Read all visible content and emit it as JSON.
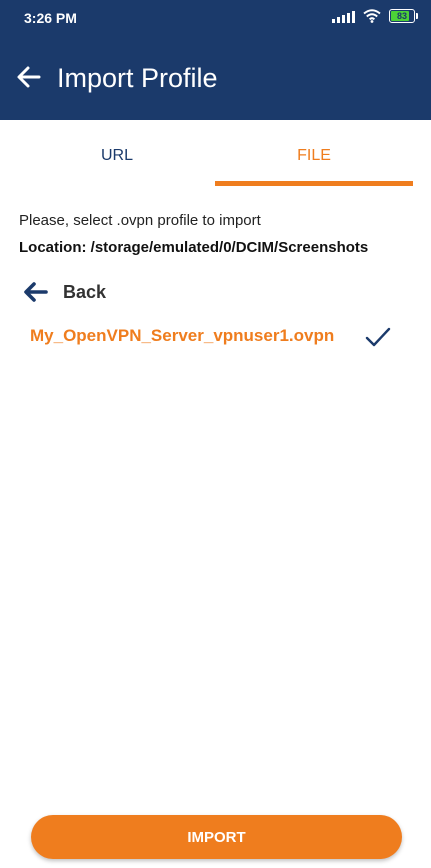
{
  "status_bar": {
    "time": "3:26 PM",
    "battery_level": 83,
    "battery_text": "83",
    "icons": [
      "signal-icon",
      "wifi-icon",
      "battery-icon"
    ]
  },
  "app_bar": {
    "title": "Import Profile",
    "back_icon": "arrow-left-icon"
  },
  "tabs": [
    {
      "label": "URL",
      "selected": false
    },
    {
      "label": "FILE",
      "selected": true
    }
  ],
  "content": {
    "instructions": "Please, select .ovpn profile to import",
    "location": "Location: /storage/emulated/0/DCIM/Screenshots",
    "back_label": "Back",
    "files": [
      {
        "name": "My_OpenVPN_Server_vpnuser1.ovpn",
        "selected": true
      }
    ]
  },
  "import_button": {
    "label": "IMPORT"
  },
  "colors": {
    "primary": "#1b3a6b",
    "accent": "#ef7d1e",
    "battery": "#4cd137"
  }
}
